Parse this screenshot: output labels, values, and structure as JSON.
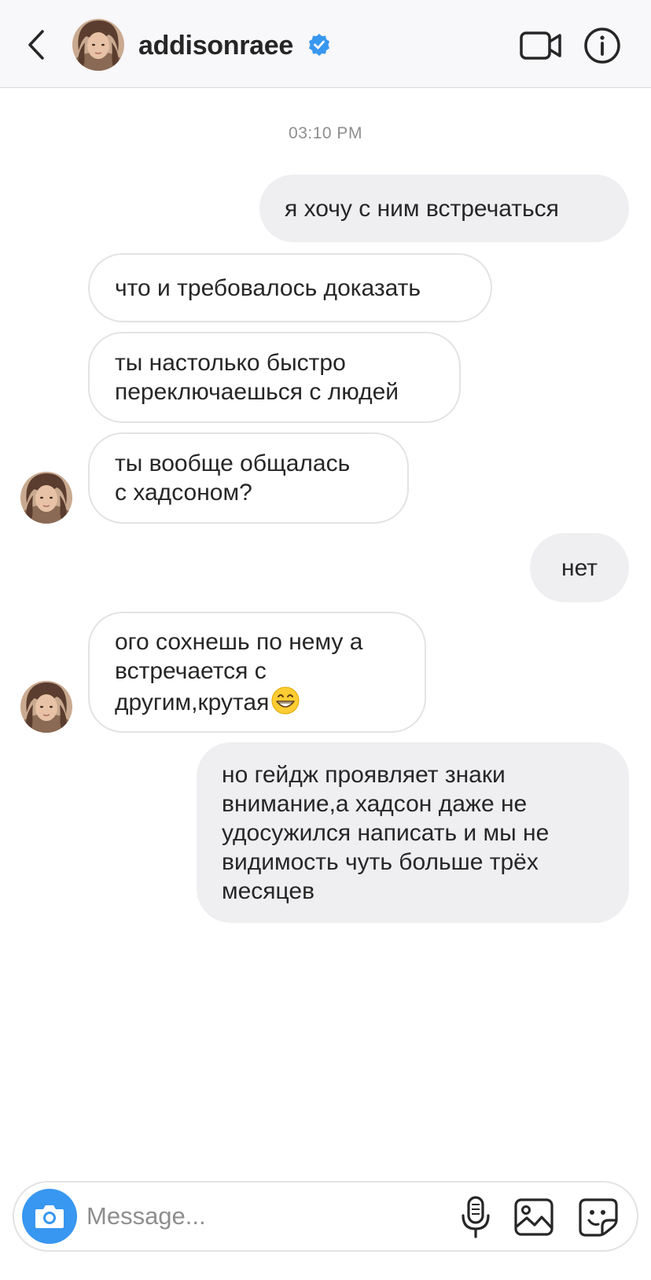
{
  "header": {
    "username": "addisonraee",
    "verified": true,
    "back_icon": "chevron-left-icon",
    "video_icon": "video-camera-icon",
    "info_icon": "info-icon"
  },
  "timestamp": "03:10 PM",
  "messages": [
    {
      "direction": "outgoing",
      "text": "я хочу с ним встречаться"
    },
    {
      "direction": "incoming",
      "text": "что и требовалось доказать"
    },
    {
      "direction": "incoming",
      "text": "ты настолько быстро\nпереключаешься с людей"
    },
    {
      "direction": "incoming",
      "text": "ты вообще общалась\nс хадсоном?"
    },
    {
      "direction": "outgoing",
      "text": "нет"
    },
    {
      "direction": "incoming",
      "text": "ого сохнешь по нему а\nвстречается с\nдругим,крутая",
      "emoji": "grinning-face-emoji"
    },
    {
      "direction": "outgoing",
      "text": "но гейдж проявляет знаки\nвнимание,а хадсон даже не\nудосужился написать и мы не\nвидимость чуть больше трёх\nмесяцев"
    }
  ],
  "composer": {
    "placeholder": "Message...",
    "value": "",
    "camera_icon": "camera-icon",
    "mic_icon": "microphone-icon",
    "gallery_icon": "gallery-icon",
    "sticker_icon": "sticker-icon"
  },
  "colors": {
    "accent": "#3897f0",
    "outgoing_bubble": "#efeef1",
    "incoming_border": "#e3e3e3",
    "header_bg": "#f8f7f9",
    "timestamp": "#8e8e8e"
  }
}
